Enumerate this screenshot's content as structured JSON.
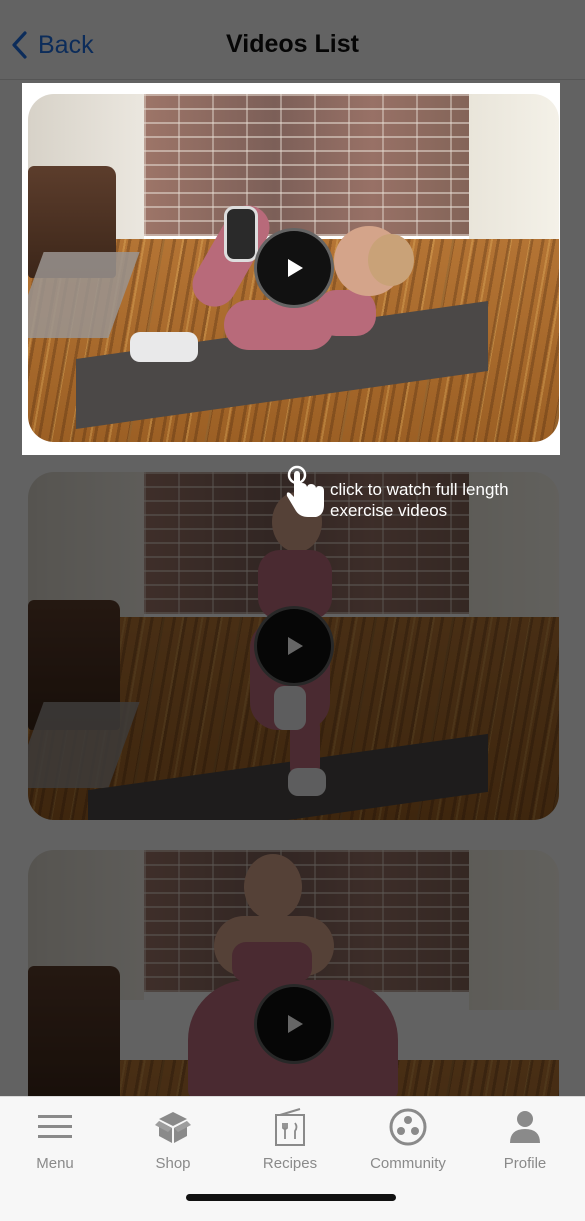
{
  "header": {
    "back_label": "Back",
    "title": "Videos List",
    "back_icon": "chevron-left-icon"
  },
  "videos": [
    {
      "play_icon": "play-icon",
      "highlighted": true
    },
    {
      "play_icon": "play-icon",
      "highlighted": false
    },
    {
      "play_icon": "play-icon",
      "highlighted": false
    }
  ],
  "hint": {
    "icon": "tap-hand-icon",
    "text_line1": "click to watch full length",
    "text_line2": "exercise videos"
  },
  "tabbar": {
    "items": [
      {
        "label": "Menu",
        "icon": "hamburger-menu-icon"
      },
      {
        "label": "Shop",
        "icon": "box-icon"
      },
      {
        "label": "Recipes",
        "icon": "recipe-card-icon"
      },
      {
        "label": "Community",
        "icon": "community-circle-icon"
      },
      {
        "label": "Profile",
        "icon": "person-icon"
      }
    ]
  },
  "colors": {
    "accent": "#1f6fe0",
    "tab_label": "#8a8a8a",
    "overlay": "rgba(0,0,0,0.6)"
  }
}
